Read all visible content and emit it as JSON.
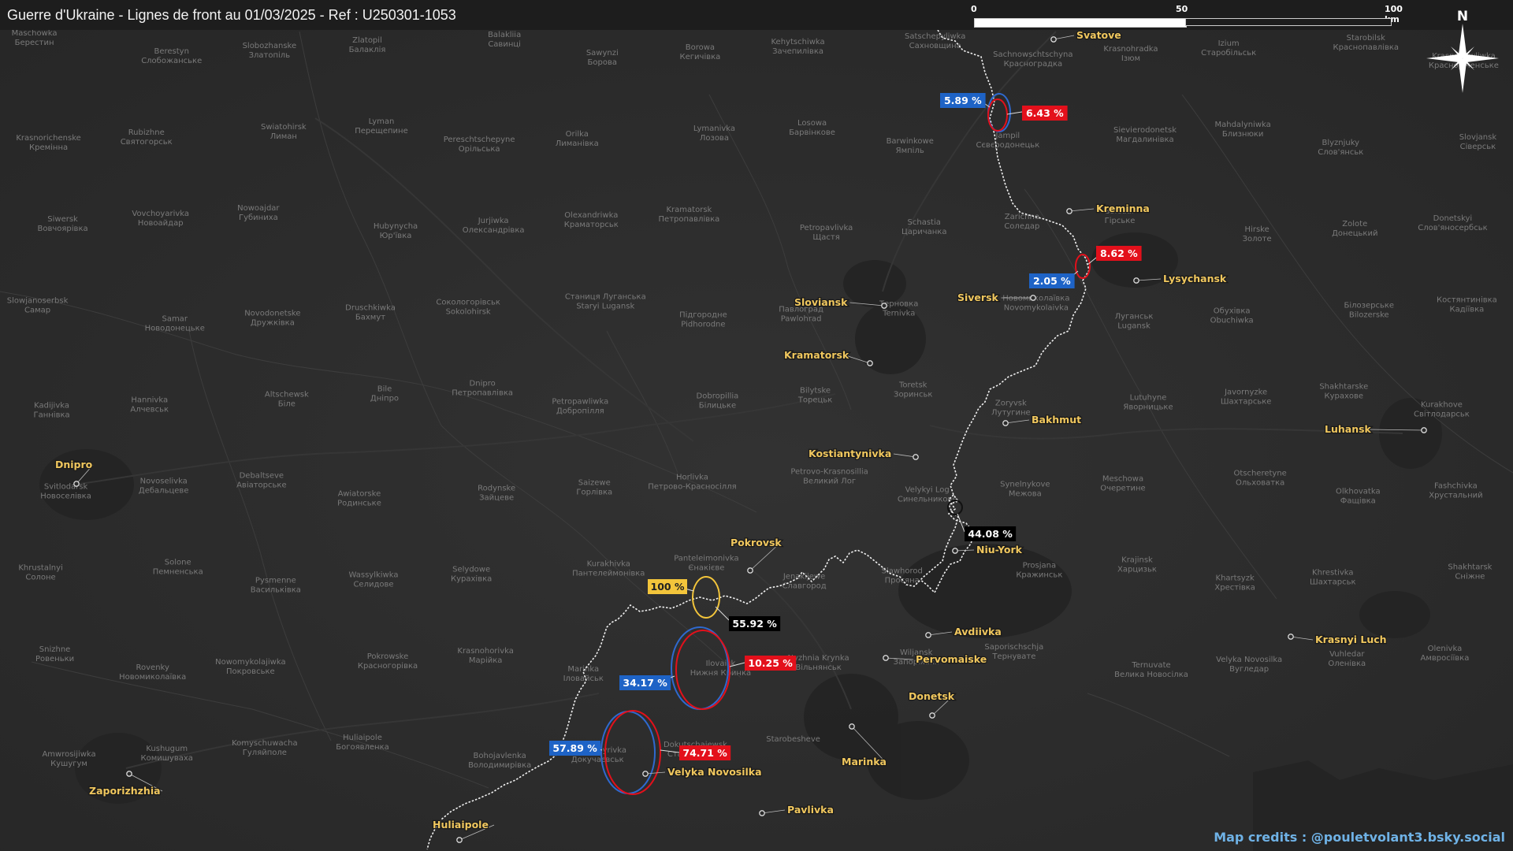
{
  "title": "Guerre d'Ukraine - Lignes de front au 01/03/2025 - Ref : U250301-1053",
  "scale_bar": {
    "ticks": [
      "0",
      "50",
      "100 km"
    ]
  },
  "compass": {
    "label": "N",
    "icon": "north-arrow-star-icon"
  },
  "credits": "Map credits : @pouletvolant3.bsky.social",
  "colors": {
    "background": "#2c2c2c",
    "front_line": "#ffffff",
    "city_label": "#f0c75e",
    "blue_badge": "#1e63c6",
    "red_badge": "#e3101b",
    "yellow_badge": "#f3c53b",
    "black_badge": "#000000"
  },
  "cities": [
    {
      "name": "Svatove"
    },
    {
      "name": "Kreminna"
    },
    {
      "name": "Lysychansk"
    },
    {
      "name": "Siversk"
    },
    {
      "name": "Sloviansk"
    },
    {
      "name": "Kramatorsk"
    },
    {
      "name": "Bakhmut"
    },
    {
      "name": "Luhansk"
    },
    {
      "name": "Kostiantynivka"
    },
    {
      "name": "Dnipro"
    },
    {
      "name": "Niu-York"
    },
    {
      "name": "Pokrovsk"
    },
    {
      "name": "Avdiivka"
    },
    {
      "name": "Krasnyi Luch"
    },
    {
      "name": "Pervomaiske"
    },
    {
      "name": "Donetsk"
    },
    {
      "name": "Marinka"
    },
    {
      "name": "Velyka Novosilka"
    },
    {
      "name": "Zaporizhzhia"
    },
    {
      "name": "Pavlivka"
    },
    {
      "name": "Huliaipole"
    }
  ],
  "badges": [
    {
      "text": "5.89 %",
      "color": "blue"
    },
    {
      "text": "6.43 %",
      "color": "red"
    },
    {
      "text": "8.62 %",
      "color": "red"
    },
    {
      "text": "2.05 %",
      "color": "blue"
    },
    {
      "text": "44.08 %",
      "color": "black"
    },
    {
      "text": "100 %",
      "color": "yellow"
    },
    {
      "text": "55.92 %",
      "color": "black"
    },
    {
      "text": "10.25 %",
      "color": "red"
    },
    {
      "text": "34.17 %",
      "color": "blue"
    },
    {
      "text": "57.89 %",
      "color": "blue"
    },
    {
      "text": "74.71 %",
      "color": "red"
    }
  ],
  "basemap_labels": [
    "Maschowka",
    "Берестин",
    "Berestyn",
    "Слобожанське",
    "Slobozhanske",
    "Златопіль",
    "Zlatopil",
    "Балаклія",
    "Balakliia",
    "Савинці",
    "Sawynzi",
    "Борова",
    "Borowa",
    "Кегичівка",
    "Kehytschiwka",
    "Зачепилівка",
    "Satschepyliwka",
    "Сахновщина",
    "Sachnowschtschyna",
    "Красноградка",
    "Krasnohradka",
    "Ізюм",
    "Izium",
    "Старобільськ",
    "Starobilsk",
    "Краснопавлівка",
    "Krasnopawliwka",
    "Красноріченське",
    "Krasnorichenske",
    "Кремінна",
    "Rubizhne",
    "Святогорськ",
    "Swiatohirsk",
    "Лиман",
    "Lyman",
    "Перещепине",
    "Pereschtschepyne",
    "Орільська",
    "Orilka",
    "Лиманівка",
    "Lymanivka",
    "Лозова",
    "Losowa",
    "Барвінкове",
    "Barwinkowe",
    "Ямпіль",
    "Jampil",
    "Сєвєродонецьк",
    "Sievierodonetsk",
    "Магдалинівка",
    "Mahdalyniwka",
    "Близнюки",
    "Blyznjuky",
    "Слов'янськ",
    "Slovjansk",
    "Сіверськ",
    "Siwersk",
    "Вовчоярівка",
    "Vovchoyarivka",
    "Новоайдар",
    "Nowoajdar",
    "Губиниха",
    "Hubynycha",
    "Юр'ївка",
    "Jurjiwka",
    "Олександрівка",
    "Olexandriwka",
    "Краматорськ",
    "Kramatorsk",
    "Петропавлівка",
    "Petropavlivka",
    "Щастя",
    "Schastia",
    "Царичанка",
    "Zarichne",
    "Соледар",
    "Soledar",
    "Гірське",
    "Hirske",
    "Золоте",
    "Zolote",
    "Донецький",
    "Donetskyi",
    "Слов'яносербськ",
    "Slowjanoserbsk",
    "Самар",
    "Samar",
    "Новодонецьке",
    "Novodonetske",
    "Дружківка",
    "Druschkiwka",
    "Бахмут",
    "Сокологорівськ",
    "Sokolohirsk",
    "Станиця Луганська",
    "Staryi Lugansk",
    "Підгородне",
    "Pidhorodne",
    "Павлоград",
    "Pawlohrad",
    "Терновка",
    "Ternivka",
    "Новомиколаївка",
    "Novomykolaivka",
    "Луганськ",
    "Lugansk",
    "Обухівка",
    "Obuchiwka",
    "Білозерське",
    "Bilozerske",
    "Костянтинівка",
    "Кадіївка",
    "Kadijivka",
    "Ганнівка",
    "Hannivka",
    "Алчевськ",
    "Altschewsk",
    "Біле",
    "Bile",
    "Дніпро",
    "Dnipro",
    "Петропавлівка",
    "Petropawliwka",
    "Добропілля",
    "Dobropillia",
    "Білицьке",
    "Bilytske",
    "Торецьк",
    "Toretsk",
    "Зоринськ",
    "Zoryvsk",
    "Лутугине",
    "Lutuhyne",
    "Яворницьке",
    "Javornyzke",
    "Шахтарське",
    "Shakhtarske",
    "Курахове",
    "Kurakhove",
    "Світлодарськ",
    "Svitlodarsk",
    "Новоселівка",
    "Novoselivka",
    "Дебальцеве",
    "Debaltseve",
    "Авіаторське",
    "Awiatorske",
    "Родинське",
    "Rodynske",
    "Зайцеве",
    "Saizewe",
    "Горлівка",
    "Horlivka",
    "Петрово-Красносілля",
    "Petrovo-Krasnosillia",
    "Великий Лог",
    "Velykyi Log",
    "Синельникове",
    "Synelnykove",
    "Межова",
    "Meschowa",
    "Очеретине",
    "Otscheretyne",
    "Ольховатка",
    "Olkhovatka",
    "Фащівка",
    "Fashchivka",
    "Хрустальний",
    "Khrustalnyi",
    "Солоне",
    "Solone",
    "Пемненська",
    "Pysmenne",
    "Васильківка",
    "Wassylkiwka",
    "Селидове",
    "Selydowe",
    "Курахівка",
    "Kurakhivka",
    "Пантелеймонівка",
    "Panteleimonivka",
    "Єнакієве",
    "Jenakijewe",
    "Славгород",
    "Slawhorod",
    "Просяна",
    "Prosjana",
    "Кражинськ",
    "Krajinsk",
    "Харцизьк",
    "Khartsyzk",
    "Хрестівка",
    "Khrestivka",
    "Шахтарськ",
    "Shakhtarsk",
    "Сніжне",
    "Snizhne",
    "Ровеньки",
    "Rovenky",
    "Новомиколаївка",
    "Nowomykolajiwka",
    "Покровське",
    "Pokrowske",
    "Красногорівка",
    "Krasnohorivka",
    "Марійка",
    "Marinka",
    "Іловайськ",
    "Ilovaisk",
    "Нижня Кринка",
    "Nyzhnia Krynka",
    "Вільнянськ",
    "Wiljansk",
    "Запоріжжя",
    "Saporischschja",
    "Тернувате",
    "Ternuvate",
    "Велика Новосілка",
    "Velyka Novosilka",
    "Вугледар",
    "Vuhledar",
    "Оленівка",
    "Olenivka",
    "Амвросіївка",
    "Amwrosijiwka",
    "Кушугум",
    "Kushugum",
    "Комишуваха",
    "Komyschuwacha",
    "Гуляйполе",
    "Huliaipole",
    "Богоявленка",
    "Bohojavlenka",
    "Володимирівка",
    "Volodymyrivka",
    "Докучаєвськ",
    "Dokutschajewsk",
    "Старобешеве",
    "Starobesheve"
  ]
}
